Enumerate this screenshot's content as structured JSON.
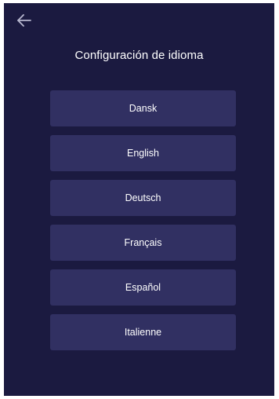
{
  "header": {
    "back_icon": "arrow-left-icon",
    "title": "Configuración de idioma"
  },
  "languages": [
    {
      "label": "Dansk"
    },
    {
      "label": "English"
    },
    {
      "label": "Deutsch"
    },
    {
      "label": "Français"
    },
    {
      "label": "Español"
    },
    {
      "label": "Italienne"
    }
  ],
  "colors": {
    "background": "#1b1a40",
    "button": "#313062",
    "text": "#ffffff",
    "icon": "#b9b9d0"
  }
}
